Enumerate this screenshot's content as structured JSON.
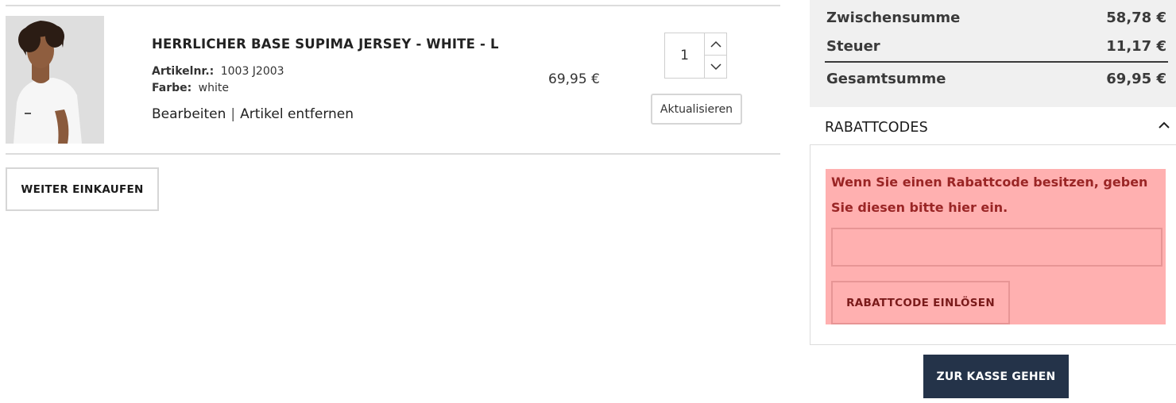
{
  "cart_item": {
    "name": "HERRLICHER BASE SUPIMA JERSEY - WHITE - L",
    "sku_label": "Artikelnr.:",
    "sku_value": "1003 J2003",
    "color_label": "Farbe:",
    "color_value": "white",
    "edit_label": "Bearbeiten",
    "separator": "|",
    "remove_label": "Artikel entfernen",
    "price": "69,95 €",
    "quantity": "1",
    "update_label": "Aktualisieren"
  },
  "continue_shopping_label": "WEITER EINKAUFEN",
  "totals": {
    "subtotal_label": "Zwischensumme",
    "subtotal_value": "58,78 €",
    "tax_label": "Steuer",
    "tax_value": "11,17 €",
    "grand_total_label": "Gesamtsumme",
    "grand_total_value": "69,95 €"
  },
  "coupon": {
    "title": "RABATTCODES",
    "hint": "Wenn Sie einen Rabattcode besitzen, geben Sie diesen bitte hier ein.",
    "input_value": "",
    "apply_label": "RABATTCODE EINLÖSEN"
  },
  "checkout_label": "ZUR KASSE GEHEN",
  "icons": {
    "qty_increase": "chevron-up-icon",
    "qty_decrease": "chevron-down-icon",
    "coupon_collapse": "chevron-up-icon"
  },
  "colors": {
    "checkout_bg": "#243349",
    "coupon_highlight": "#ffb0b0",
    "coupon_text": "#9a2525",
    "totals_bg": "#f0f0f0"
  }
}
